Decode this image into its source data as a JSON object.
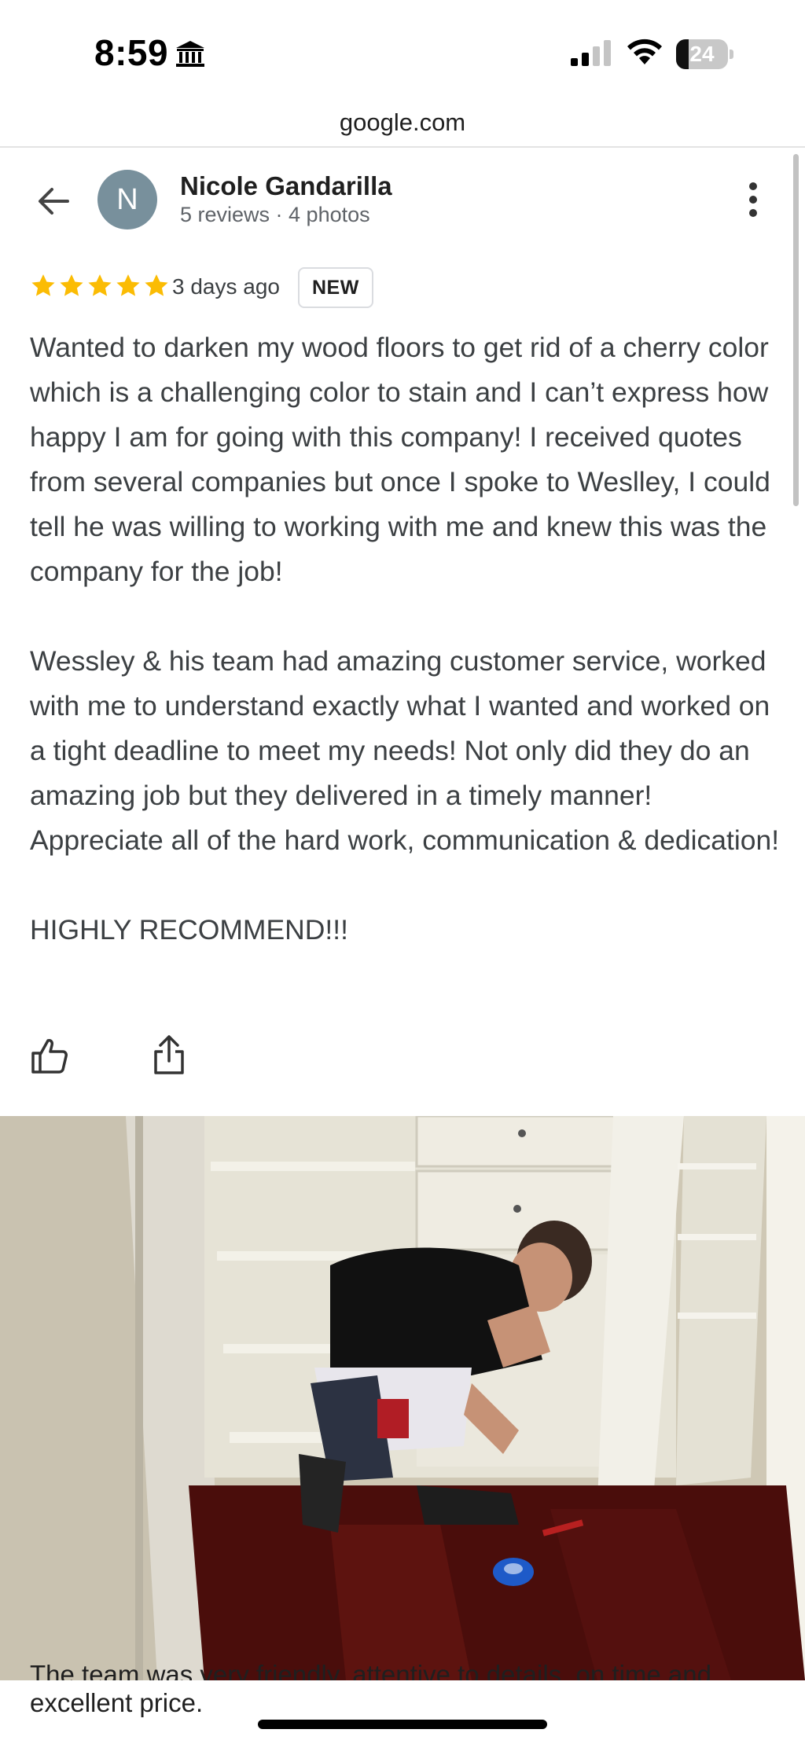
{
  "status_bar": {
    "time": "8:59",
    "battery": "24",
    "battery_level": 0.24
  },
  "url_bar": {
    "url": "google.com"
  },
  "reviewer": {
    "avatar_initial": "N",
    "name": "Nicole Gandarilla",
    "meta": "5 reviews · 4 photos"
  },
  "review": {
    "rating": 5,
    "date": "3 days ago",
    "badge": "NEW",
    "paragraphs": [
      "Wanted to darken my wood floors to get rid of a cherry color which is a challenging color to stain and I can’t express how happy I am for going with this company! I received quotes from several companies but once I spoke to Weslley, I could tell he was willing to working with me and knew this was the company for the job!",
      "Wessley & his team had amazing customer service, worked with me to understand exactly what I wanted and worked on a tight deadline to meet my needs! Not only did they do an amazing job but they delivered in a timely manner! Appreciate all of the hard work, communication & dedication!",
      "HIGHLY RECOMMEND!!!"
    ]
  },
  "next_review": {
    "line1": "The team was very friendly, attentive to details, on time and",
    "line2": "excellent price."
  },
  "icons": {
    "back": "arrow-left-icon",
    "more": "more-vertical-icon",
    "like": "thumbs-up-icon",
    "share": "share-icon",
    "star": "star-icon",
    "bank": "bank-icon",
    "signal": "signal-icon",
    "wifi": "wifi-icon"
  },
  "colors": {
    "star": "#fbbc04",
    "avatar": "#78909c",
    "floor": "#4a0d0b"
  }
}
